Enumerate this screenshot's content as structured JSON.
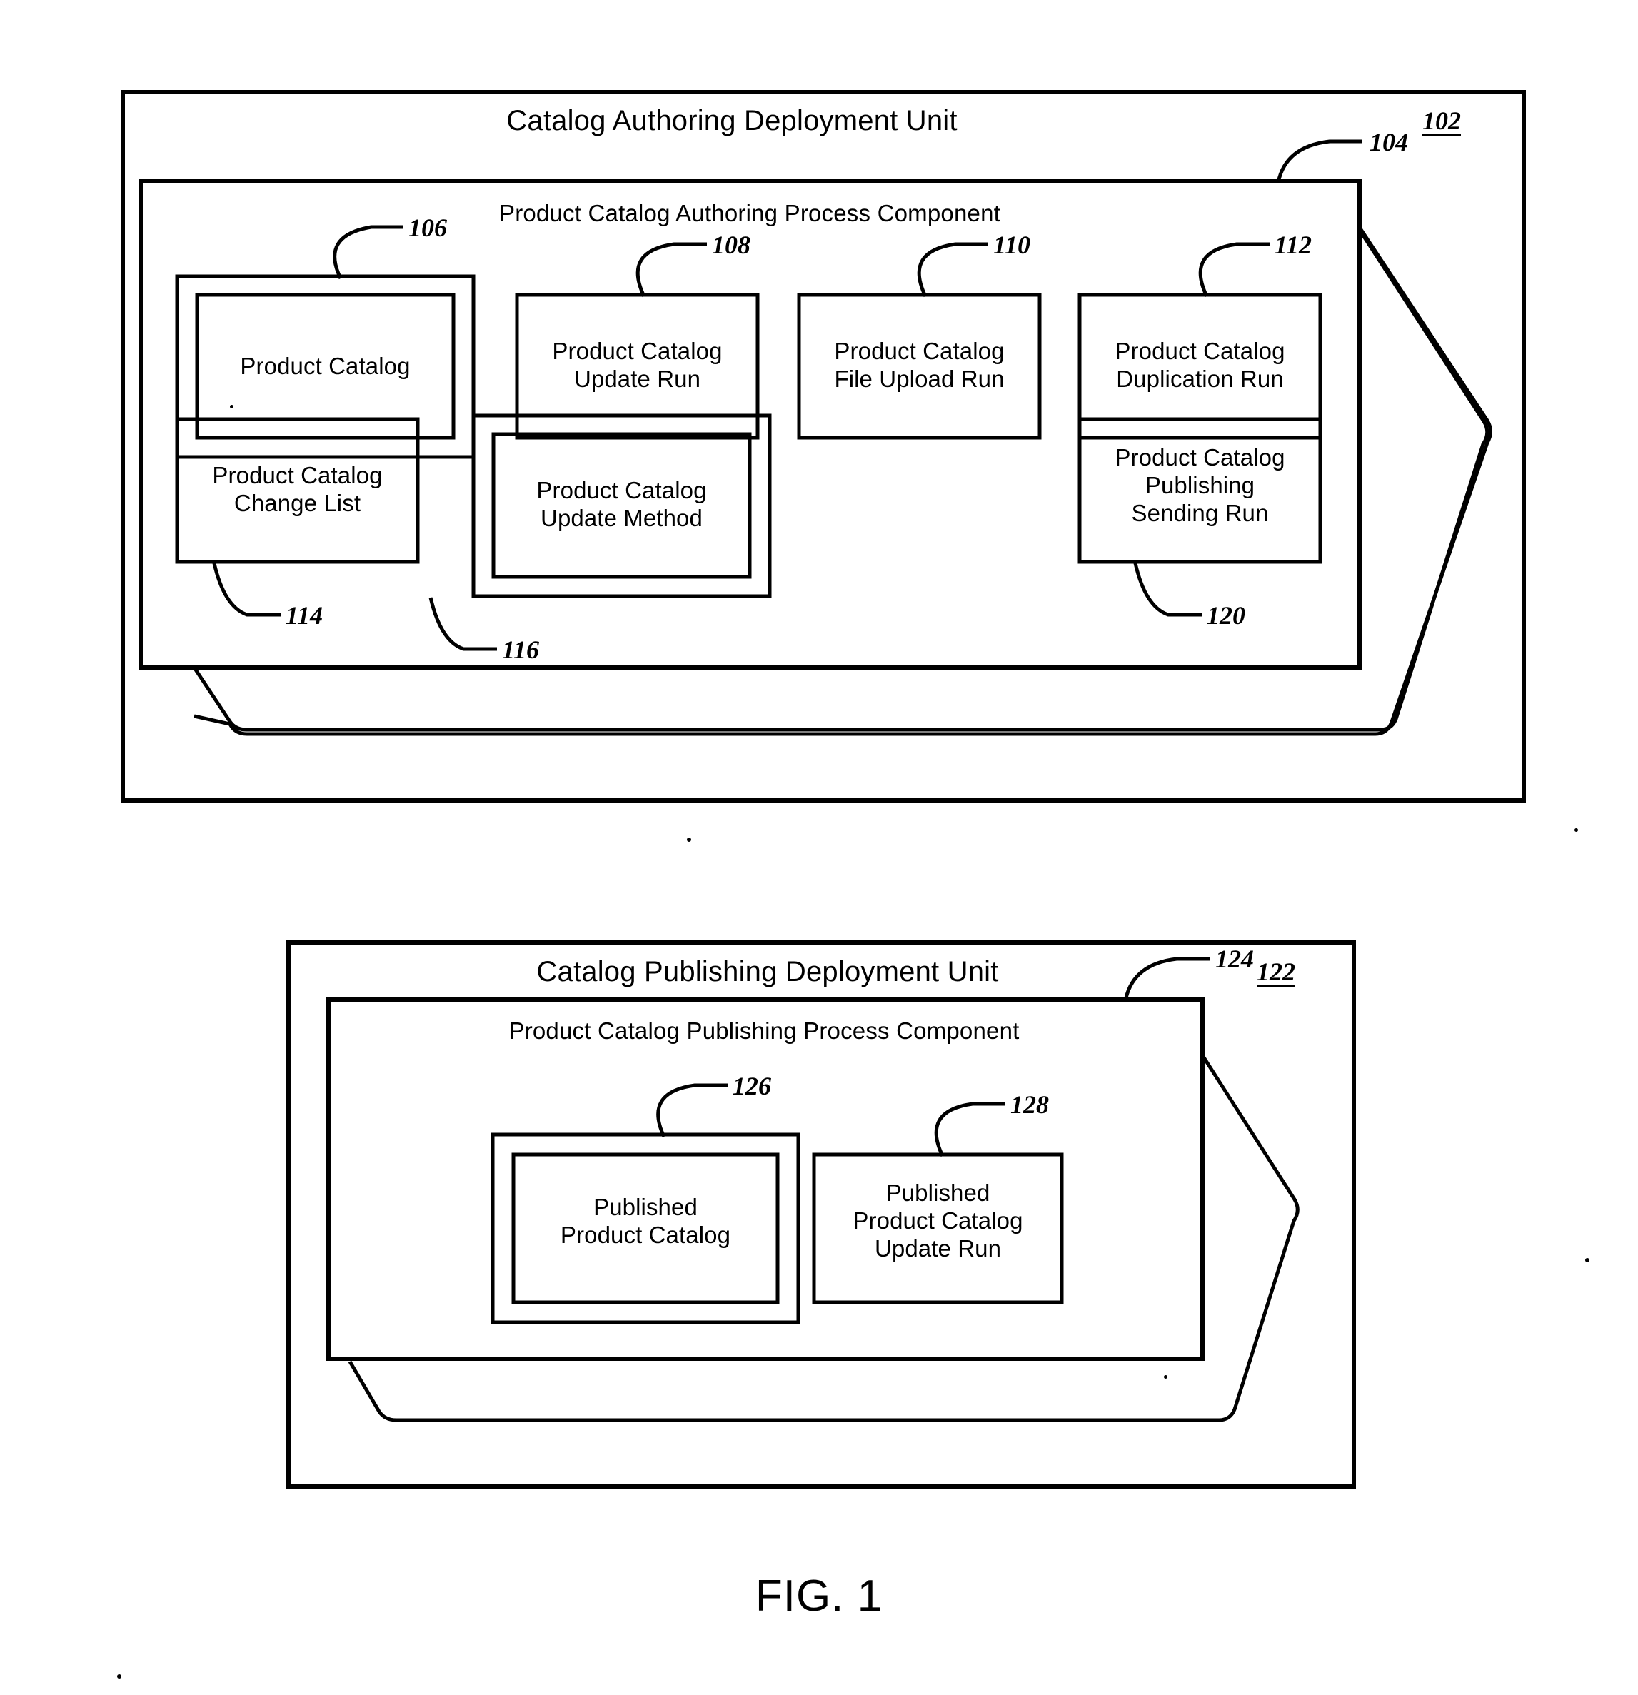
{
  "figure": {
    "caption": "FIG. 1"
  },
  "units": [
    {
      "id": "catalog-authoring-deployment-unit",
      "title": "Catalog Authoring Deployment Unit",
      "ref": "102",
      "component": {
        "id": "product-catalog-authoring-process-component",
        "title": "Product Catalog Authoring Process Component",
        "ref": "104",
        "boxes": [
          {
            "id": "product-catalog",
            "label": "Product Catalog",
            "ref": "106",
            "double": true,
            "ref_position": "top"
          },
          {
            "id": "product-catalog-update-run",
            "label": "Product Catalog\nUpdate Run",
            "ref": "108",
            "double": false,
            "ref_position": "top"
          },
          {
            "id": "product-catalog-file-upload-run",
            "label": "Product Catalog\nFile Upload Run",
            "ref": "110",
            "double": false,
            "ref_position": "top"
          },
          {
            "id": "product-catalog-duplication-run",
            "label": "Product Catalog\nDuplication Run",
            "ref": "112",
            "double": false,
            "ref_position": "top"
          },
          {
            "id": "product-catalog-change-list",
            "label": "Product Catalog\nChange List",
            "ref": "114",
            "double": false,
            "ref_position": "bottom"
          },
          {
            "id": "product-catalog-update-method",
            "label": "Product Catalog\nUpdate Method",
            "ref": "116",
            "double": true,
            "ref_position": "bottom"
          },
          {
            "id": "product-catalog-publishing-sending-run",
            "label": "Product Catalog\nPublishing\nSending Run",
            "ref": "120",
            "double": false,
            "ref_position": "bottom"
          }
        ]
      }
    },
    {
      "id": "catalog-publishing-deployment-unit",
      "title": "Catalog Publishing Deployment Unit",
      "ref": "122",
      "component": {
        "id": "product-catalog-publishing-process-component",
        "title": "Product Catalog Publishing Process Component",
        "ref": "124",
        "boxes": [
          {
            "id": "published-product-catalog",
            "label": "Published\nProduct Catalog",
            "ref": "126",
            "double": true,
            "ref_position": "top"
          },
          {
            "id": "published-product-catalog-update-run",
            "label": "Published\nProduct Catalog\nUpdate Run",
            "ref": "128",
            "double": false,
            "ref_position": "top"
          }
        ]
      }
    }
  ],
  "colors": {
    "stroke": "#000000",
    "background": "#ffffff"
  }
}
